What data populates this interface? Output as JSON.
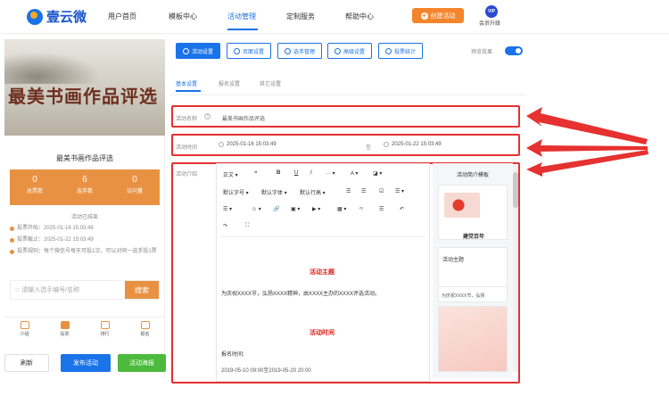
{
  "header": {
    "logo_text": "壹云微",
    "nav": [
      "用户首页",
      "模板中心",
      "活动管理",
      "定制服务",
      "帮助中心"
    ],
    "create_button": "创建活动",
    "vip_badge": "VIP",
    "vip_label": "会员升级"
  },
  "preview": {
    "banner_title": "最美书画作品评选",
    "title": "最美书画作品评选",
    "stats": [
      {
        "value": "0",
        "label": "总票数"
      },
      {
        "value": "6",
        "label": "选手数"
      },
      {
        "value": "0",
        "label": "访问量"
      }
    ],
    "status": "活动已结束",
    "info": [
      "投票开始：2025-01-16 15:03:49",
      "投票截止：2025-01-22 15:03:49",
      "投票规则：每个微信号每天可投1次，可以对同一选手投1票"
    ],
    "search_placeholder": "请输入选手编号/名称",
    "search_button": "搜索",
    "tabs": [
      "介绍",
      "投票",
      "排行",
      "报名"
    ],
    "buttons": {
      "refresh": "刷新",
      "publish": "发布活动",
      "qrcode": "活动海报"
    }
  },
  "toolbar": {
    "tabs": [
      "活动设置",
      "页面设置",
      "选手管理",
      "高级设置",
      "投票统计"
    ],
    "preview_label": "预览效果"
  },
  "subtabs": [
    "基本设置",
    "报名设置",
    "其它设置"
  ],
  "form": {
    "name_label": "活动名称",
    "name_value": "最美书画作品评选",
    "time_label": "活动时间",
    "start_time": "2025-01-16 15:03:49",
    "end_time": "2025-01-22 15:03:49",
    "time_separator": "至",
    "intro_label": "活动介绍"
  },
  "editor": {
    "toolbar_row1": [
      "正文 ▾",
      "❝",
      "B",
      "U",
      "I",
      "··· ▾",
      "A ▾",
      "◪ ▾"
    ],
    "toolbar_row2": [
      "默认字号 ▾",
      "默认字体 ▾",
      "默认行高 ▾",
      "☰",
      "☰",
      "☑",
      "☰ ▾"
    ],
    "toolbar_row3": [
      "☰ ▾",
      "☺ ▾",
      "🔗",
      "▣ ▾",
      "▶ ▾",
      "▦ ▾",
      "‹›",
      "☰",
      "↶"
    ],
    "toolbar_row4": [
      "↷",
      "⛶"
    ],
    "heading1": "活动主题",
    "paragraph1": "为庆祝XXXX节，弘扬XXXX精神，由XXXX主办的XXXX评选活动。",
    "heading2": "活动时间",
    "signup_label": "报名时间:",
    "signup_value": "2019-05-10 09:00至2019-05-20 20:00"
  },
  "template_panel": {
    "title": "活动简介模板",
    "card1_text": "建党百年",
    "card2_text": "活动主题",
    "card3_text": "为庆祝XXXX节，弘扬"
  },
  "colors": {
    "accent": "#1a73e8",
    "orange": "#e99142",
    "red": "#e5312f"
  }
}
